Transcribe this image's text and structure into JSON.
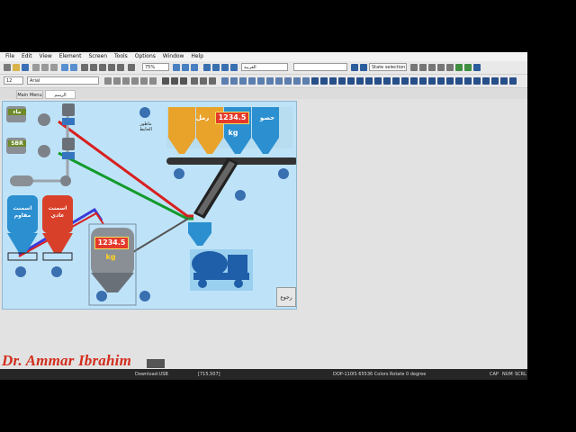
{
  "menu": {
    "items": [
      "File",
      "Edit",
      "View",
      "Element",
      "Screen",
      "Tools",
      "Options",
      "Window",
      "Help"
    ]
  },
  "toolbar1": {
    "zoom_value": "75%",
    "language_value": "العربية",
    "state_value": "State selection..."
  },
  "toolbar2": {
    "font_size": "12",
    "font_name": "Arial"
  },
  "tabs": [
    {
      "label": "Main Menu"
    },
    {
      "label": "الرسم"
    }
  ],
  "screen": {
    "water_label": "ماء",
    "sbr_label": "SBR",
    "sand_label": "رمل",
    "gravel_label": "حصو",
    "main_display": "1234.5",
    "main_unit": "kg",
    "mixer_display": "1234.5",
    "mixer_unit": "kg",
    "cement_resistant_label": "اسمنت مقاوم",
    "cement_normal_label": "اسمنت عادي",
    "wall_note": "ماطور الحايط",
    "back_button": "رجوع"
  },
  "status": {
    "download": "Download:USB",
    "coords": "[715,507]",
    "device": "DOP-110IS 65536 Colors Rotate 0 degree",
    "caps": "CAP",
    "num": "NUM",
    "scrl": "SCRL"
  },
  "watermark": "Dr. Ammar Ibrahim",
  "colors": {
    "canvas_bg": "#bee3f8",
    "display_bg": "#e5392b",
    "pipe_red": "#d82020",
    "pipe_green": "#139a2c",
    "pipe_blue": "#3a3ad8",
    "silo_orange": "#e9a22a",
    "silo_blue": "#2b8fd0",
    "truck_blue": "#1f5ea8",
    "watermark": "#d32d1c"
  }
}
